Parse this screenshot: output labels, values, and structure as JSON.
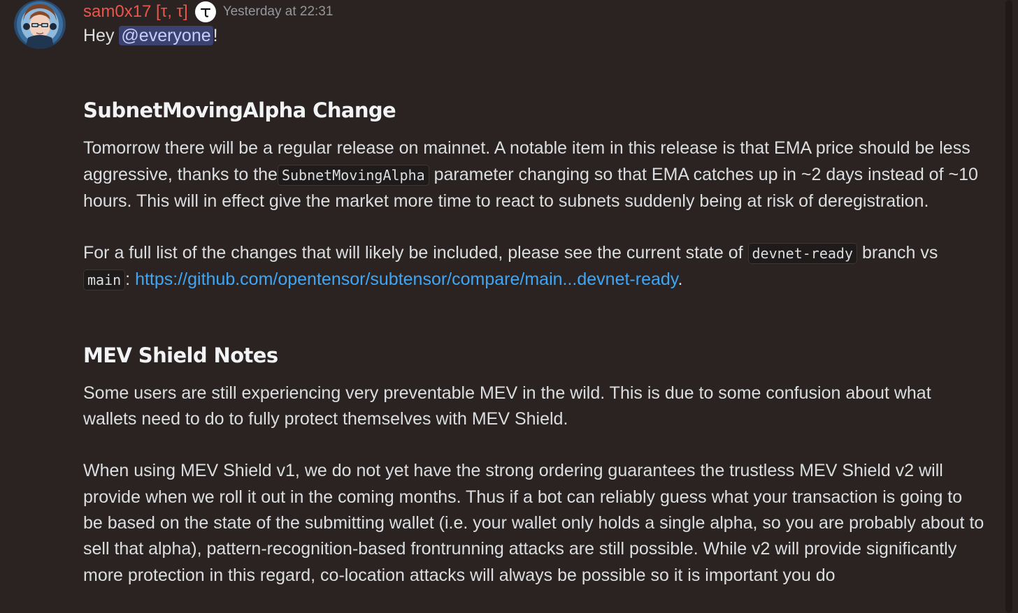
{
  "message": {
    "username": "sam0x17 [τ, τ]",
    "timestamp": "Yesterday at 22:31",
    "role_icon": "tao-icon",
    "greeting_prefix": "Hey ",
    "mention": "@everyone",
    "greeting_suffix": "!"
  },
  "section1": {
    "heading": "SubnetMovingAlpha Change",
    "p1_part1": "Tomorrow there will be a regular release on mainnet. A notable item in this release is that EMA price should be less aggressive, thanks to  the",
    "p1_code": "SubnetMovingAlpha",
    "p1_part2": " parameter changing so that EMA catches up in ~2 days instead of ~10 hours. This will in effect give the market more time to react to subnets suddenly being at risk of deregistration.",
    "p2_part1": "For a full list of the changes that will likely be included, please see the current state of ",
    "p2_code1": "devnet-ready",
    "p2_part2": " branch vs ",
    "p2_code2": "main",
    "p2_part3": ": ",
    "p2_link": "https://github.com/opentensor/subtensor/compare/main...devnet-ready",
    "p2_part4": "."
  },
  "section2": {
    "heading": "MEV Shield Notes",
    "p1": "Some users are still experiencing very preventable MEV in the wild. This is due to some confusion about what wallets need to do to fully protect themselves with MEV Shield.",
    "p2": "When using MEV Shield v1, we do not yet have the strong ordering guarantees the trustless MEV Shield v2 will provide when we roll it out in the coming months. Thus if a bot can reliably guess what your transaction is going to be based on the state of the submitting wallet (i.e. your wallet only holds a single alpha, so you are probably about to sell that alpha), pattern-recognition-based frontrunning attacks are still possible. While v2 will provide significantly more protection in this regard, co-location attacks will always be possible so it is important you do"
  },
  "colors": {
    "background": "#2b2321",
    "username": "#e8574c",
    "link": "#3fa6f5",
    "mention_bg": "#3b4270"
  }
}
